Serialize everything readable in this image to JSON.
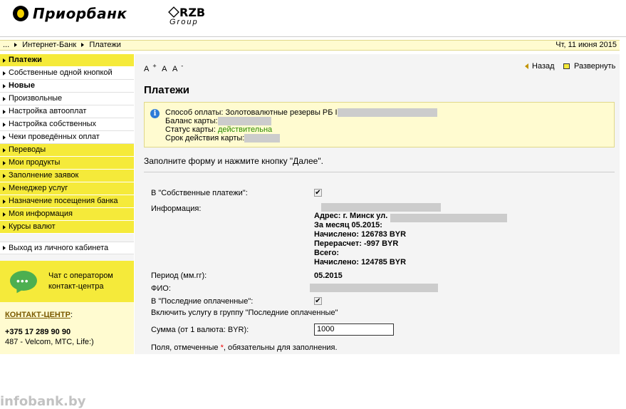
{
  "header": {
    "bank_name": "Приорбанк",
    "partner_logo": "RZB",
    "partner_group": "Group"
  },
  "breadcrumb": {
    "root": "...",
    "items": [
      "Интернет-Банк",
      "Платежи"
    ],
    "date": "Чт, 11 июня 2015"
  },
  "sidebar": {
    "items": [
      {
        "label": "Платежи"
      },
      {
        "label": "Собственные одной кнопкой"
      },
      {
        "label": "Новые"
      },
      {
        "label": "Произвольные"
      },
      {
        "label": "Настройка автооплат"
      },
      {
        "label": "Настройка собственных"
      },
      {
        "label": "Чеки проведённых оплат"
      },
      {
        "label": "Переводы"
      },
      {
        "label": "Мои продукты"
      },
      {
        "label": "Заполнение заявок"
      },
      {
        "label": "Менеджер услуг"
      },
      {
        "label": "Назначение посещения банка"
      },
      {
        "label": "Моя информация"
      },
      {
        "label": "Курсы валют"
      }
    ],
    "logout": "Выход из личного кабинета",
    "chat_line1": "Чат с оператором",
    "chat_line2": "контакт-центра",
    "contact_title": "КОНТАКТ-ЦЕНТР",
    "contact_colon": ":",
    "phone1": "+375 17 289 90 90",
    "phone2": "487 - Velcom, МТС, Life:)",
    "watermark": "infobank.by"
  },
  "main": {
    "font_small": "A",
    "font_normal": "A",
    "font_large": "A",
    "back_label": "Назад",
    "expand_label": "Развернуть",
    "title": "Платежи",
    "info": {
      "pay_method_label": "Способ оплаты: Золотовалютные резервы РБ I",
      "balance_label": "Баланс карты:",
      "status_label": "Статус карты: ",
      "status_value": "действительна",
      "expiry_label": "Срок действия карты:"
    },
    "intro": "Заполните форму и нажмите кнопку \"Далее\".",
    "own_payments_label": "В \"Собственные платежи\":",
    "information_label": "Информация:",
    "details": [
      "Адрес: г. Минск ул.",
      "За месяц 05.2015:",
      "Начислено: 126783 BYR",
      "Перерасчет: -997 BYR",
      "Всего:",
      "Начислено: 124785 BYR"
    ],
    "period_label": "Период (мм.гг):",
    "period_value": "05.2015",
    "fio_label": "ФИО:",
    "last_paid_label": "В \"Последние оплаченные\":",
    "include_group_label": "Включить услугу в группу \"Последние оплаченные\"",
    "sum_label": "Сумма (от 1 валюта: BYR):",
    "sum_value": "1000",
    "required_note_prefix": "Поля, отмеченные ",
    "required_star": "*",
    "required_note_suffix": ", обязательны для заполнения."
  }
}
